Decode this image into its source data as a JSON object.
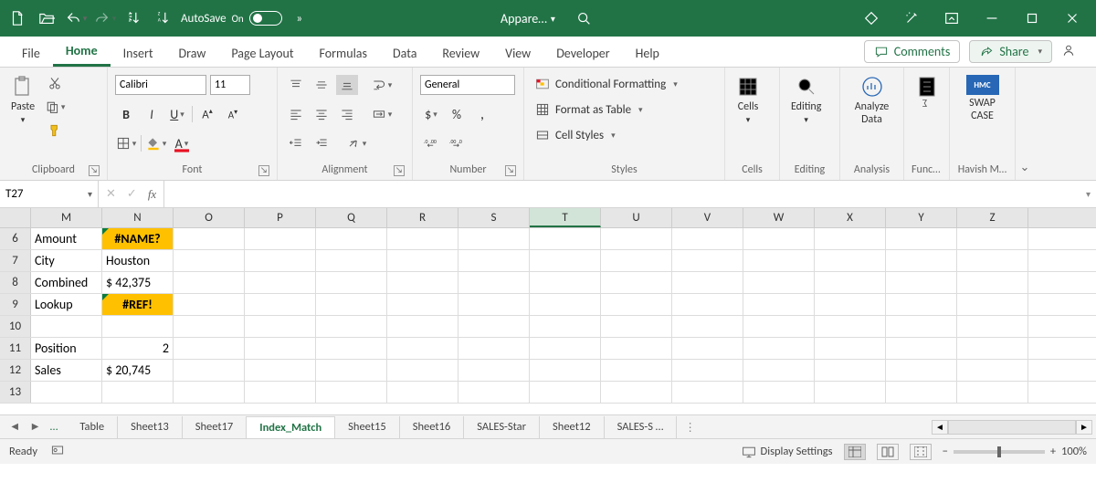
{
  "titlebar": {
    "autosave_label": "AutoSave",
    "autosave_state": "On",
    "doc_title": "Appare…",
    "overflow": "»"
  },
  "tabs": {
    "items": [
      "File",
      "Home",
      "Insert",
      "Draw",
      "Page Layout",
      "Formulas",
      "Data",
      "Review",
      "View",
      "Developer",
      "Help"
    ],
    "active": "Home",
    "comments": "Comments",
    "share": "Share"
  },
  "ribbon": {
    "clipboard": {
      "label": "Clipboard",
      "paste": "Paste"
    },
    "font": {
      "label": "Font",
      "name": "Calibri",
      "size": "11"
    },
    "alignment": {
      "label": "Alignment"
    },
    "number": {
      "label": "Number",
      "format": "General"
    },
    "styles": {
      "label": "Styles",
      "cond": "Conditional Formatting",
      "table": "Format as Table",
      "cell": "Cell Styles"
    },
    "cells": {
      "label": "Cells",
      "btn": "Cells"
    },
    "editing": {
      "label": "Editing",
      "btn": "Editing"
    },
    "analysis": {
      "label": "Analysis",
      "btn": "Analyze Data"
    },
    "functi": {
      "label": "Functi…"
    },
    "havish": {
      "label": "Havish M…",
      "btn": "SWAP CASE"
    }
  },
  "formula_bar": {
    "name_box": "T27",
    "formula": ""
  },
  "grid": {
    "columns": [
      "M",
      "N",
      "O",
      "P",
      "Q",
      "R",
      "S",
      "T",
      "U",
      "V",
      "W",
      "X",
      "Y",
      "Z"
    ],
    "selected_col": "T",
    "rows": [
      {
        "n": "6",
        "cells": [
          {
            "v": "Amount"
          },
          {
            "v": "#NAME?",
            "err": true
          }
        ]
      },
      {
        "n": "7",
        "cells": [
          {
            "v": "City"
          },
          {
            "v": "Houston"
          }
        ]
      },
      {
        "n": "8",
        "cells": [
          {
            "v": "Combined"
          },
          {
            "v": "$ 42,375"
          }
        ]
      },
      {
        "n": "9",
        "cells": [
          {
            "v": "Lookup"
          },
          {
            "v": "#REF!",
            "err": true
          }
        ]
      },
      {
        "n": "10",
        "cells": []
      },
      {
        "n": "11",
        "cells": [
          {
            "v": "Position"
          },
          {
            "v": "2",
            "r": true
          }
        ]
      },
      {
        "n": "12",
        "cells": [
          {
            "v": "Sales"
          },
          {
            "v": "$ 20,745"
          }
        ]
      },
      {
        "n": "13",
        "cells": []
      }
    ]
  },
  "sheet_tabs": {
    "items": [
      "Table",
      "Sheet13",
      "Sheet17",
      "Index_Match",
      "Sheet15",
      "Sheet16",
      "SALES-Star",
      "Sheet12",
      "SALES-S …"
    ],
    "active": "Index_Match"
  },
  "statusbar": {
    "ready": "Ready",
    "display": "Display Settings",
    "zoom": "100%"
  }
}
